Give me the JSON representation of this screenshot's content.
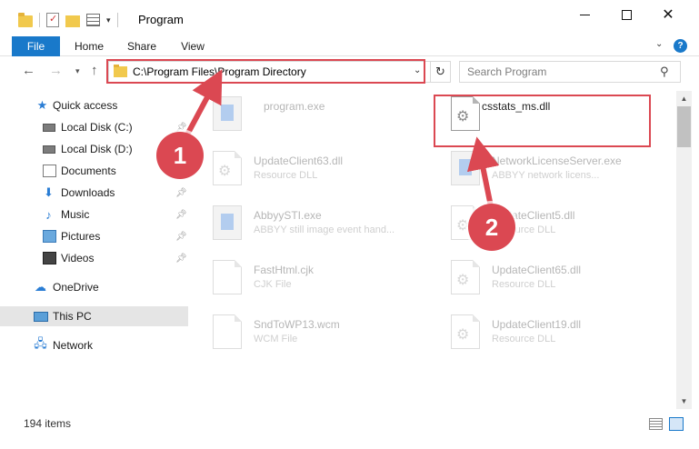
{
  "window": {
    "title": "Program",
    "minimize_label": "",
    "maximize_label": "",
    "close_label": "✕"
  },
  "ribbon": {
    "tabs": [
      "File",
      "Home",
      "Share",
      "View"
    ],
    "help": "?"
  },
  "address": {
    "path": "C:\\Program Files\\Program Directory",
    "search_placeholder": "Search Program"
  },
  "sidebar": {
    "items": [
      {
        "label": "Quick access",
        "icon": "star-icon"
      },
      {
        "label": "Local Disk (C:)",
        "icon": "drive-icon"
      },
      {
        "label": "Local Disk (D:)",
        "icon": "drive-icon"
      },
      {
        "label": "Documents",
        "icon": "documents-icon"
      },
      {
        "label": "Downloads",
        "icon": "downloads-icon"
      },
      {
        "label": "Music",
        "icon": "music-icon"
      },
      {
        "label": "Pictures",
        "icon": "pictures-icon"
      },
      {
        "label": "Videos",
        "icon": "videos-icon"
      },
      {
        "label": "OneDrive",
        "icon": "cloud-icon"
      },
      {
        "label": "This PC",
        "icon": "computer-icon"
      },
      {
        "label": "Network",
        "icon": "network-icon"
      }
    ],
    "selected": "This PC"
  },
  "files": [
    {
      "name": "program.exe",
      "type": ""
    },
    {
      "name": "csstats_ms.dll",
      "type": ""
    },
    {
      "name": "UpdateClient63.dll",
      "type": "Resource DLL"
    },
    {
      "name": "NetworkLicenseServer.exe",
      "type": "ABBYY network licens..."
    },
    {
      "name": "AbbyySTI.exe",
      "type": "ABBYY still image event hand..."
    },
    {
      "name": "UpdateClient5.dll",
      "type": "Resource DLL"
    },
    {
      "name": "FastHtml.cjk",
      "type": "CJK File"
    },
    {
      "name": "UpdateClient65.dll",
      "type": "Resource DLL"
    },
    {
      "name": "SndToWP13.wcm",
      "type": "WCM File"
    },
    {
      "name": "UpdateClient19.dll",
      "type": "Resource DLL"
    }
  ],
  "annotations": {
    "step1": "1",
    "step2": "2",
    "color": "#db4852"
  },
  "status": {
    "item_count": "194 items"
  }
}
